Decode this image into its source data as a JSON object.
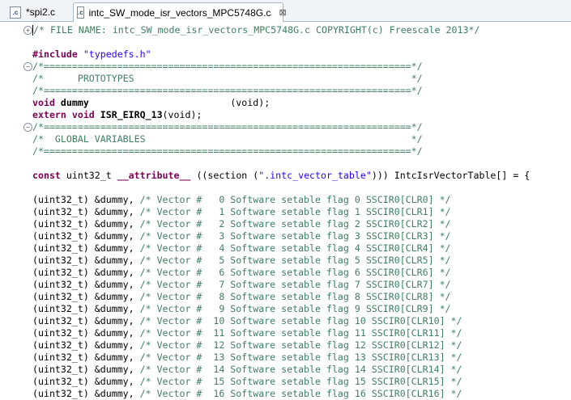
{
  "tabs": [
    {
      "label": "*spi2.c",
      "active": false
    },
    {
      "label": "intc_SW_mode_isr_vectors_MPC5748G.c",
      "active": true
    }
  ],
  "tab_close_glyph": "⊠",
  "file_icon_text": ".c",
  "code": {
    "header_comment": "/* FILE NAME: intc_SW_mode_isr_vectors_MPC5748G.c COPYRIGHT(c) Freescale 2013*/",
    "include_kw": "#include",
    "include_file": "\"typedefs.h\"",
    "sep": "/*=================================================================*/",
    "prototypes": "/*      PROTOTYPES                                                 */",
    "void_kw": "void",
    "dummy_name": "dummy",
    "dummy_args": "                         (void);",
    "extern_kw": "extern void",
    "isr_name": "ISR_EIRQ_13",
    "isr_args": "(void);",
    "globals": "/*  GLOBAL VARIABLES                                               */",
    "const_kw": "const",
    "decl_type": "uint32_t",
    "attr_kw": "__attribute__",
    "section_open": "((section (",
    "section_str": "\".intc_vector_table\"",
    "section_close": "))) IntcIsrVectorTable[] = {",
    "vector_prefix": "(uint32_t) &dummy,",
    "vectors": [
      "/* Vector #   0 Software setable flag 0 SSCIR0[CLR0] */",
      "/* Vector #   1 Software setable flag 1 SSCIR0[CLR1] */",
      "/* Vector #   2 Software setable flag 2 SSCIR0[CLR2] */",
      "/* Vector #   3 Software setable flag 3 SSCIR0[CLR3] */",
      "/* Vector #   4 Software setable flag 4 SSCIR0[CLR4] */",
      "/* Vector #   5 Software setable flag 5 SSCIR0[CLR5] */",
      "/* Vector #   6 Software setable flag 6 SSCIR0[CLR6] */",
      "/* Vector #   7 Software setable flag 7 SSCIR0[CLR7] */",
      "/* Vector #   8 Software setable flag 8 SSCIR0[CLR8] */",
      "/* Vector #   9 Software setable flag 9 SSCIR0[CLR9] */",
      "/* Vector #  10 Software setable flag 10 SSCIR0[CLR10] */",
      "/* Vector #  11 Software setable flag 11 SSCIR0[CLR11] */",
      "/* Vector #  12 Software setable flag 12 SSCIR0[CLR12] */",
      "/* Vector #  13 Software setable flag 13 SSCIR0[CLR13] */",
      "/* Vector #  14 Software setable flag 14 SSCIR0[CLR14] */",
      "/* Vector #  15 Software setable flag 15 SSCIR0[CLR15] */",
      "/* Vector #  16 Software setable flag 16 SSCIR0[CLR16] */"
    ]
  }
}
